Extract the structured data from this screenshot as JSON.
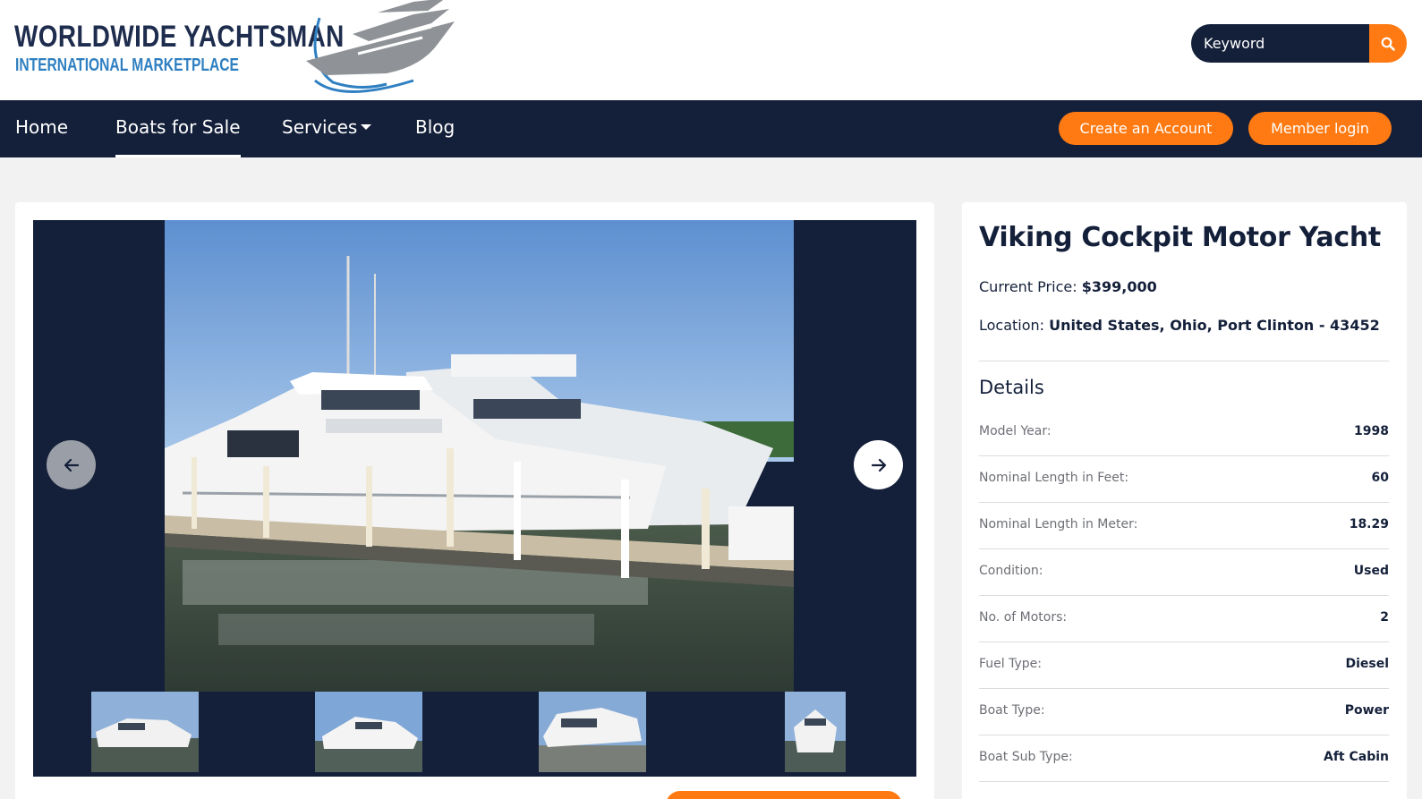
{
  "header": {
    "logo_title": "WORLDWIDE YACHTSMAN",
    "logo_subtitle": "INTERNATIONAL MARKETPLACE",
    "search_placeholder": "Keyword",
    "search_icon": "search-icon"
  },
  "nav": {
    "items": [
      {
        "label": "Home"
      },
      {
        "label": "Boats for Sale",
        "active": true
      },
      {
        "label": "Services",
        "has_dropdown": true
      },
      {
        "label": "Blog"
      }
    ],
    "create_account": "Create an Account",
    "member_login": "Member login"
  },
  "gallery": {
    "prev_icon": "arrow-left-icon",
    "next_icon": "arrow-right-icon",
    "thumbnail_count": 4
  },
  "listing": {
    "title": "Viking Cockpit Motor Yacht",
    "price_label": "Current Price:",
    "price": "$399,000",
    "location_label": "Location:",
    "location": "United States, Ohio, Port Clinton - 43452",
    "details_heading": "Details",
    "details": [
      {
        "label": "Model Year:",
        "value": "1998"
      },
      {
        "label": "Nominal Length in Feet:",
        "value": "60"
      },
      {
        "label": "Nominal Length in Meter:",
        "value": "18.29"
      },
      {
        "label": "Condition:",
        "value": "Used"
      },
      {
        "label": "No. of Motors:",
        "value": "2"
      },
      {
        "label": "Fuel Type:",
        "value": "Diesel"
      },
      {
        "label": "Boat Type:",
        "value": "Power"
      },
      {
        "label": "Boat Sub Type:",
        "value": "Aft Cabin"
      }
    ]
  },
  "colors": {
    "navy": "#14203a",
    "accent": "#ff7a12",
    "logo_blue": "#2f7fc1"
  }
}
